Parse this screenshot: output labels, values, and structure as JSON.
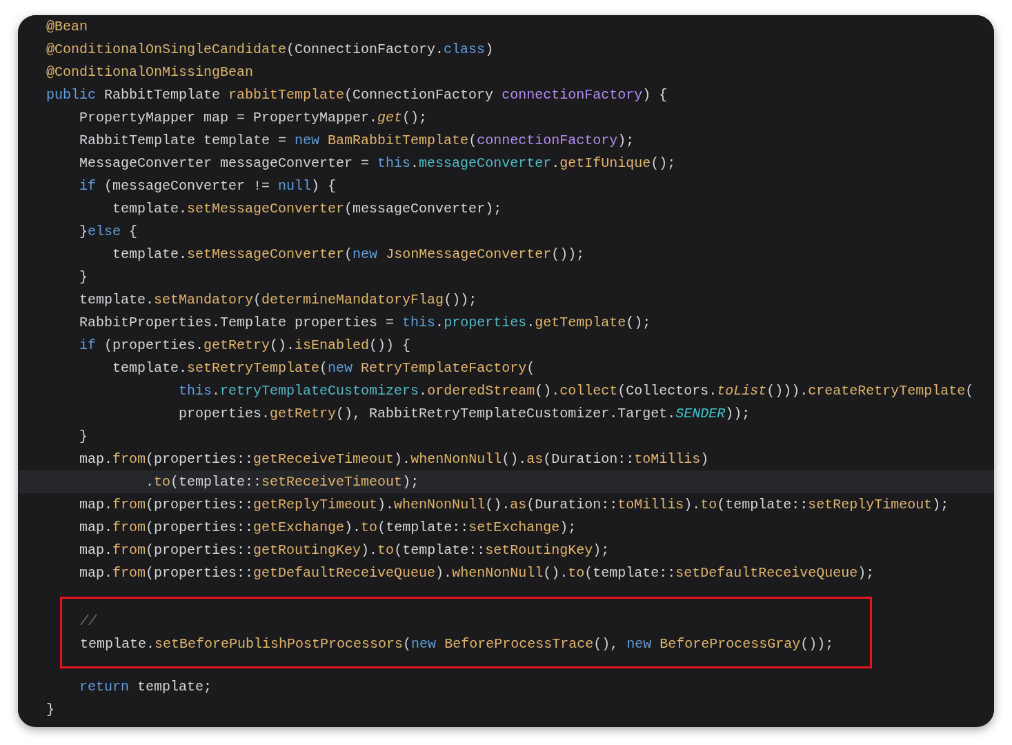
{
  "sections": [
    {
      "boxed": false,
      "lines": [
        {
          "current": false,
          "tokens": [
            {
              "text": "@Bean",
              "kind": "annotation"
            }
          ]
        },
        {
          "current": false,
          "tokens": [
            {
              "text": "@ConditionalOnSingleCandidate",
              "kind": "annotation"
            },
            {
              "text": "(ConnectionFactory.",
              "kind": "plain"
            },
            {
              "text": "class",
              "kind": "keyword"
            },
            {
              "text": ")",
              "kind": "plain"
            }
          ]
        },
        {
          "current": false,
          "tokens": [
            {
              "text": "@ConditionalOnMissingBean",
              "kind": "annotation"
            }
          ]
        },
        {
          "current": false,
          "tokens": [
            {
              "text": "public",
              "kind": "keyword"
            },
            {
              "text": " RabbitTemplate ",
              "kind": "plain"
            },
            {
              "text": "rabbitTemplate",
              "kind": "method"
            },
            {
              "text": "(ConnectionFactory ",
              "kind": "plain"
            },
            {
              "text": "connectionFactory",
              "kind": "param"
            },
            {
              "text": ") {",
              "kind": "plain"
            }
          ]
        },
        {
          "current": false,
          "tokens": [
            {
              "text": "    PropertyMapper map = PropertyMapper.",
              "kind": "plain"
            },
            {
              "text": "get",
              "kind": "static_method"
            },
            {
              "text": "();",
              "kind": "plain"
            }
          ]
        },
        {
          "current": false,
          "tokens": [
            {
              "text": "    RabbitTemplate template = ",
              "kind": "plain"
            },
            {
              "text": "new",
              "kind": "keyword"
            },
            {
              "text": " BamRabbitTemplate",
              "kind": "method"
            },
            {
              "text": "(",
              "kind": "plain"
            },
            {
              "text": "connectionFactory",
              "kind": "param"
            },
            {
              "text": ");",
              "kind": "plain"
            }
          ]
        },
        {
          "current": false,
          "tokens": [
            {
              "text": "    MessageConverter messageConverter = ",
              "kind": "plain"
            },
            {
              "text": "this",
              "kind": "keyword"
            },
            {
              "text": ".",
              "kind": "plain"
            },
            {
              "text": "messageConverter",
              "kind": "field"
            },
            {
              "text": ".",
              "kind": "plain"
            },
            {
              "text": "getIfUnique",
              "kind": "method"
            },
            {
              "text": "();",
              "kind": "plain"
            }
          ]
        },
        {
          "current": false,
          "tokens": [
            {
              "text": "    if",
              "kind": "keyword"
            },
            {
              "text": " (messageConverter != ",
              "kind": "plain"
            },
            {
              "text": "null",
              "kind": "keyword"
            },
            {
              "text": ") {",
              "kind": "plain"
            }
          ]
        },
        {
          "current": false,
          "tokens": [
            {
              "text": "        template.",
              "kind": "plain"
            },
            {
              "text": "setMessageConverter",
              "kind": "method"
            },
            {
              "text": "(messageConverter);",
              "kind": "plain"
            }
          ]
        },
        {
          "current": false,
          "tokens": [
            {
              "text": "    }",
              "kind": "plain"
            },
            {
              "text": "else",
              "kind": "keyword"
            },
            {
              "text": " {",
              "kind": "plain"
            }
          ]
        },
        {
          "current": false,
          "tokens": [
            {
              "text": "        template.",
              "kind": "plain"
            },
            {
              "text": "setMessageConverter",
              "kind": "method"
            },
            {
              "text": "(",
              "kind": "plain"
            },
            {
              "text": "new",
              "kind": "keyword"
            },
            {
              "text": " JsonMessageConverter",
              "kind": "method"
            },
            {
              "text": "());",
              "kind": "plain"
            }
          ]
        },
        {
          "current": false,
          "tokens": [
            {
              "text": "    }",
              "kind": "plain"
            }
          ]
        },
        {
          "current": false,
          "tokens": [
            {
              "text": "    template.",
              "kind": "plain"
            },
            {
              "text": "setMandatory",
              "kind": "method"
            },
            {
              "text": "(",
              "kind": "plain"
            },
            {
              "text": "determineMandatoryFlag",
              "kind": "method"
            },
            {
              "text": "());",
              "kind": "plain"
            }
          ]
        },
        {
          "current": false,
          "tokens": [
            {
              "text": "    RabbitProperties.Template properties = ",
              "kind": "plain"
            },
            {
              "text": "this",
              "kind": "keyword"
            },
            {
              "text": ".",
              "kind": "plain"
            },
            {
              "text": "properties",
              "kind": "field"
            },
            {
              "text": ".",
              "kind": "plain"
            },
            {
              "text": "getTemplate",
              "kind": "method"
            },
            {
              "text": "();",
              "kind": "plain"
            }
          ]
        },
        {
          "current": false,
          "tokens": [
            {
              "text": "    if",
              "kind": "keyword"
            },
            {
              "text": " (properties.",
              "kind": "plain"
            },
            {
              "text": "getRetry",
              "kind": "method"
            },
            {
              "text": "().",
              "kind": "plain"
            },
            {
              "text": "isEnabled",
              "kind": "method"
            },
            {
              "text": "()) {",
              "kind": "plain"
            }
          ]
        },
        {
          "current": false,
          "tokens": [
            {
              "text": "        template.",
              "kind": "plain"
            },
            {
              "text": "setRetryTemplate",
              "kind": "method"
            },
            {
              "text": "(",
              "kind": "plain"
            },
            {
              "text": "new",
              "kind": "keyword"
            },
            {
              "text": " RetryTemplateFactory",
              "kind": "method"
            },
            {
              "text": "(",
              "kind": "plain"
            }
          ]
        },
        {
          "current": false,
          "tokens": [
            {
              "text": "                this",
              "kind": "keyword"
            },
            {
              "text": ".",
              "kind": "plain"
            },
            {
              "text": "retryTemplateCustomizers",
              "kind": "field"
            },
            {
              "text": ".",
              "kind": "plain"
            },
            {
              "text": "orderedStream",
              "kind": "method"
            },
            {
              "text": "().",
              "kind": "plain"
            },
            {
              "text": "collect",
              "kind": "method"
            },
            {
              "text": "(Collectors.",
              "kind": "plain"
            },
            {
              "text": "toList",
              "kind": "static_method"
            },
            {
              "text": "())).",
              "kind": "plain"
            },
            {
              "text": "createRetryTemplate",
              "kind": "method"
            },
            {
              "text": "(",
              "kind": "plain"
            }
          ]
        },
        {
          "current": false,
          "tokens": [
            {
              "text": "                properties.",
              "kind": "plain"
            },
            {
              "text": "getRetry",
              "kind": "method"
            },
            {
              "text": "(), RabbitRetryTemplateCustomizer.Target.",
              "kind": "plain"
            },
            {
              "text": "SENDER",
              "kind": "constant"
            },
            {
              "text": "));",
              "kind": "plain"
            }
          ]
        },
        {
          "current": false,
          "tokens": [
            {
              "text": "    }",
              "kind": "plain"
            }
          ]
        },
        {
          "current": false,
          "tokens": [
            {
              "text": "    map.",
              "kind": "plain"
            },
            {
              "text": "from",
              "kind": "method"
            },
            {
              "text": "(properties::",
              "kind": "plain"
            },
            {
              "text": "getReceiveTimeout",
              "kind": "method"
            },
            {
              "text": ").",
              "kind": "plain"
            },
            {
              "text": "whenNonNull",
              "kind": "method"
            },
            {
              "text": "().",
              "kind": "plain"
            },
            {
              "text": "as",
              "kind": "method"
            },
            {
              "text": "(Duration::",
              "kind": "plain"
            },
            {
              "text": "toMillis",
              "kind": "method"
            },
            {
              "text": ")",
              "kind": "plain"
            }
          ]
        },
        {
          "current": true,
          "tokens": [
            {
              "text": "            .",
              "kind": "plain"
            },
            {
              "text": "to",
              "kind": "method"
            },
            {
              "text": "(template::",
              "kind": "plain"
            },
            {
              "text": "setReceiveTimeout",
              "kind": "method"
            },
            {
              "text": ");",
              "kind": "plain"
            }
          ]
        },
        {
          "current": false,
          "tokens": [
            {
              "text": "    map.",
              "kind": "plain"
            },
            {
              "text": "from",
              "kind": "method"
            },
            {
              "text": "(properties::",
              "kind": "plain"
            },
            {
              "text": "getReplyTimeout",
              "kind": "method"
            },
            {
              "text": ").",
              "kind": "plain"
            },
            {
              "text": "whenNonNull",
              "kind": "method"
            },
            {
              "text": "().",
              "kind": "plain"
            },
            {
              "text": "as",
              "kind": "method"
            },
            {
              "text": "(Duration::",
              "kind": "plain"
            },
            {
              "text": "toMillis",
              "kind": "method"
            },
            {
              "text": ").",
              "kind": "plain"
            },
            {
              "text": "to",
              "kind": "method"
            },
            {
              "text": "(template::",
              "kind": "plain"
            },
            {
              "text": "setReplyTimeout",
              "kind": "method"
            },
            {
              "text": ");",
              "kind": "plain"
            }
          ]
        },
        {
          "current": false,
          "tokens": [
            {
              "text": "    map.",
              "kind": "plain"
            },
            {
              "text": "from",
              "kind": "method"
            },
            {
              "text": "(properties::",
              "kind": "plain"
            },
            {
              "text": "getExchange",
              "kind": "method"
            },
            {
              "text": ").",
              "kind": "plain"
            },
            {
              "text": "to",
              "kind": "method"
            },
            {
              "text": "(template::",
              "kind": "plain"
            },
            {
              "text": "setExchange",
              "kind": "method"
            },
            {
              "text": ");",
              "kind": "plain"
            }
          ]
        },
        {
          "current": false,
          "tokens": [
            {
              "text": "    map.",
              "kind": "plain"
            },
            {
              "text": "from",
              "kind": "method"
            },
            {
              "text": "(properties::",
              "kind": "plain"
            },
            {
              "text": "getRoutingKey",
              "kind": "method"
            },
            {
              "text": ").",
              "kind": "plain"
            },
            {
              "text": "to",
              "kind": "method"
            },
            {
              "text": "(template::",
              "kind": "plain"
            },
            {
              "text": "setRoutingKey",
              "kind": "method"
            },
            {
              "text": ");",
              "kind": "plain"
            }
          ]
        },
        {
          "current": false,
          "tokens": [
            {
              "text": "    map.",
              "kind": "plain"
            },
            {
              "text": "from",
              "kind": "method"
            },
            {
              "text": "(properties::",
              "kind": "plain"
            },
            {
              "text": "getDefaultReceiveQueue",
              "kind": "method"
            },
            {
              "text": ").",
              "kind": "plain"
            },
            {
              "text": "whenNonNull",
              "kind": "method"
            },
            {
              "text": "().",
              "kind": "plain"
            },
            {
              "text": "to",
              "kind": "method"
            },
            {
              "text": "(template::",
              "kind": "plain"
            },
            {
              "text": "setDefaultReceiveQueue",
              "kind": "method"
            },
            {
              "text": ");",
              "kind": "plain"
            }
          ]
        }
      ]
    },
    {
      "boxed": true,
      "lines": [
        {
          "current": false,
          "tokens": [
            {
              "text": "//",
              "kind": "comment"
            }
          ]
        },
        {
          "current": false,
          "tokens": [
            {
              "text": "template.",
              "kind": "plain"
            },
            {
              "text": "setBeforePublishPostProcessors",
              "kind": "method"
            },
            {
              "text": "(",
              "kind": "plain"
            },
            {
              "text": "new",
              "kind": "keyword"
            },
            {
              "text": " BeforeProcessTrace",
              "kind": "method"
            },
            {
              "text": "(), ",
              "kind": "plain"
            },
            {
              "text": "new",
              "kind": "keyword"
            },
            {
              "text": " BeforeProcessGray",
              "kind": "method"
            },
            {
              "text": "());",
              "kind": "plain"
            }
          ]
        }
      ]
    },
    {
      "boxed": false,
      "lines": [
        {
          "current": false,
          "tokens": [
            {
              "text": "    return",
              "kind": "keyword"
            },
            {
              "text": " template;",
              "kind": "plain"
            }
          ]
        },
        {
          "current": false,
          "tokens": [
            {
              "text": "}",
              "kind": "plain"
            }
          ]
        }
      ]
    }
  ]
}
